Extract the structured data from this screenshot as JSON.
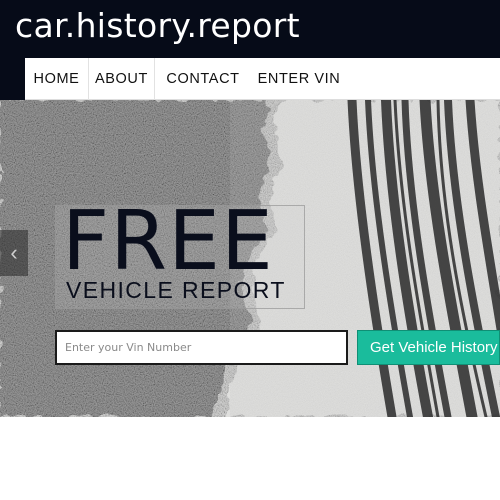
{
  "header": {
    "site_title": "car.history.report"
  },
  "nav": {
    "items": [
      {
        "label": "HOME"
      },
      {
        "label": "ABOUT"
      },
      {
        "label": "CONTACT"
      },
      {
        "label": "ENTER VIN"
      }
    ]
  },
  "hero": {
    "headline": "FREE",
    "subheadline": "VEHICLE REPORT",
    "prev_icon": "chevron-left-icon"
  },
  "vin_form": {
    "placeholder": "Enter your Vin Number",
    "button_label": "Get Vehicle History"
  },
  "colors": {
    "header_bg": "#060b18",
    "accent": "#1abc9c"
  }
}
